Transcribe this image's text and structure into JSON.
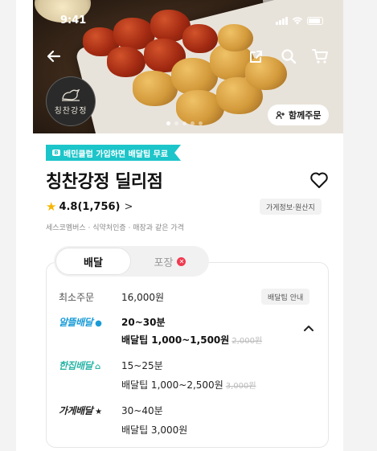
{
  "status": {
    "time": "9:41"
  },
  "hero": {
    "logo_text": "칭찬강정",
    "dots_count": 5,
    "dots_active_index": 0,
    "together_button": "함께주문"
  },
  "store": {
    "promo_badge": "배민클럽 가입하면 배달팁 무료",
    "name": "칭찬강정 딜리점",
    "rating": "4.8(1,756)",
    "rating_chevron": ">",
    "info_button": "가게정보·원산지",
    "meta": "세스코멤버스 · 식약처인증 · 매장과 같은 가격"
  },
  "tabs": {
    "delivery": "배달",
    "pickup": "포장"
  },
  "delivery": {
    "min_order_label": "최소주문",
    "min_order_value": "16,000원",
    "tip_guide_button": "배달팁 안내",
    "options": [
      {
        "brand": "알뜰배달",
        "time": "20~30분",
        "tip": "배달팁 1,000~1,500원",
        "original_tip": "2,000원"
      },
      {
        "brand": "한집배달",
        "time": "15~25분",
        "tip": "배달팁 1,000~2,500원",
        "original_tip": "3,000원"
      },
      {
        "brand": "가게배달",
        "time": "30~40분",
        "tip": "배달팁 3,000원",
        "original_tip": ""
      }
    ]
  },
  "colors": {
    "promo": "#1cc5c9",
    "alddle": "#1a9bd7",
    "hanjib": "#2bb5a8",
    "star": "#f7b500",
    "pickup_badge": "#f0394f"
  }
}
